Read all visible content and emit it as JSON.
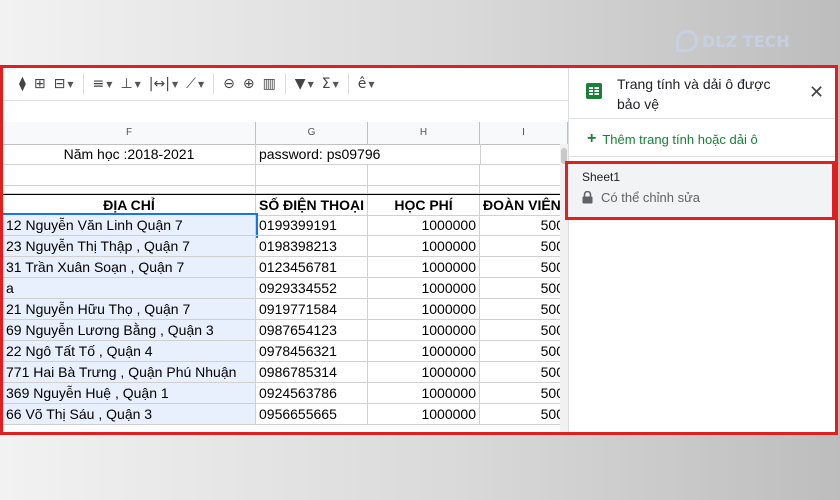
{
  "watermark": {
    "text": "DLZ TECH"
  },
  "toolbar": {
    "items": [
      {
        "icon": "paint-bucket-icon",
        "glyph": "⧫"
      },
      {
        "icon": "borders-icon",
        "glyph": "⊞"
      },
      {
        "icon": "merge-cells-icon",
        "glyph": "⊟"
      },
      {
        "icon": "align-left-icon",
        "glyph": "≡"
      },
      {
        "icon": "vertical-align-icon",
        "glyph": "⊥"
      },
      {
        "icon": "text-wrap-icon",
        "glyph": "|↔|"
      },
      {
        "icon": "text-rotate-icon",
        "glyph": "⟋"
      },
      {
        "icon": "link-icon",
        "glyph": "⊖"
      },
      {
        "icon": "insert-comment-icon",
        "glyph": "⊕"
      },
      {
        "icon": "insert-chart-icon",
        "glyph": "▥"
      },
      {
        "icon": "filter-icon",
        "glyph": "▼"
      },
      {
        "icon": "functions-icon",
        "glyph": "Σ"
      },
      {
        "icon": "input-tools-icon",
        "glyph": "ê"
      }
    ]
  },
  "columns": [
    "F",
    "G",
    "H",
    "I"
  ],
  "sheet": {
    "row1": {
      "F": "Năm học :2018-2021",
      "G": "password: ps09796"
    },
    "headers": {
      "F": "ĐỊA CHỈ",
      "G": "SỐ ĐIỆN THOẠI",
      "H": "HỌC PHÍ",
      "I": "ĐOÀN VIÊN"
    },
    "rows": [
      {
        "address": "12 Nguyễn Văn Linh Quận 7",
        "phone": "0199399191",
        "fee": "1000000",
        "union": "500"
      },
      {
        "address": "23 Nguyễn Thị Thập , Quận 7",
        "phone": "0198398213",
        "fee": "1000000",
        "union": "500"
      },
      {
        "address": "31 Trần Xuân Soạn , Quận 7",
        "phone": "0123456781",
        "fee": "1000000",
        "union": "500"
      },
      {
        "address": "a",
        "phone": "0929334552",
        "fee": "1000000",
        "union": "500"
      },
      {
        "address": "21 Nguyễn Hữu Thọ , Quận 7",
        "phone": "0919771584",
        "fee": "1000000",
        "union": "500"
      },
      {
        "address": "69 Nguyễn Lương Bằng , Quận 3",
        "phone": "0987654123",
        "fee": "1000000",
        "union": "500"
      },
      {
        "address": "22 Ngô Tất Tố , Quận 4",
        "phone": "0978456321",
        "fee": "1000000",
        "union": "500"
      },
      {
        "address": "771 Hai Bà Trưng , Quận Phú Nhuận",
        "phone": "0986785314",
        "fee": "1000000",
        "union": "500"
      },
      {
        "address": "369 Nguyễn Huệ , Quận 1",
        "phone": "0924563786",
        "fee": "1000000",
        "union": "500"
      },
      {
        "address": "66 Võ Thị Sáu , Quận 3",
        "phone": "0956655665",
        "fee": "1000000",
        "union": "500"
      }
    ]
  },
  "panel": {
    "title": "Trang tính và dải ô được bảo vệ",
    "add_label": "Thêm trang tính hoặc dải ô",
    "protected": [
      {
        "name": "Sheet1",
        "permission": "Có thể chỉnh sửa"
      }
    ]
  },
  "colors": {
    "highlight": "#e02020",
    "accent_green": "#188038",
    "selection": "#e8f0fe"
  }
}
